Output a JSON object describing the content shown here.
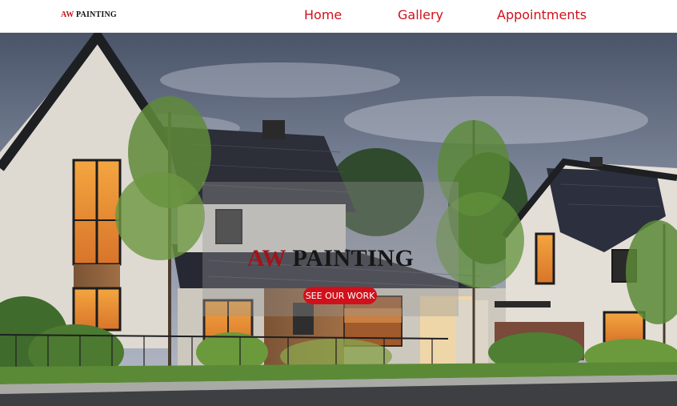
{
  "brand": {
    "logo_aw": "AW",
    "logo_rest": "PAINTING"
  },
  "nav": {
    "home": "Home",
    "gallery": "Gallery",
    "appointments": "Appointments"
  },
  "hero": {
    "title_aw": "AW",
    "title_rest": "PAINTING",
    "cta_label": "SEE OUR WORK"
  },
  "colors": {
    "accent": "#d0111c",
    "logo_accent": "#c4121a",
    "text_dark": "#161616"
  }
}
